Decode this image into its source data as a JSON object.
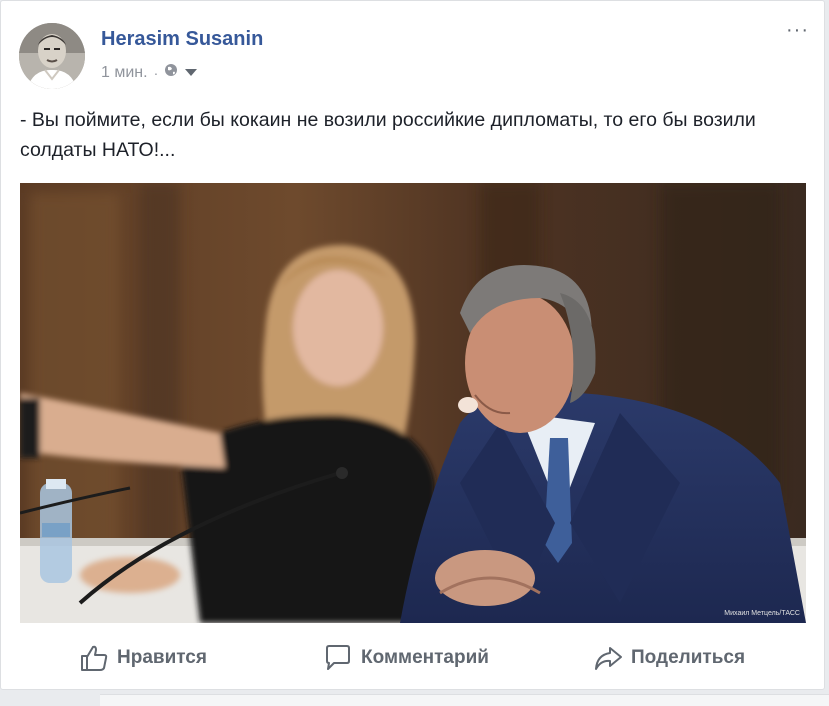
{
  "post": {
    "author": "Herasim Susanin",
    "time": "1 мин.",
    "separator": "·",
    "more": "···",
    "text": "- Вы поймите, если бы кокаин не возили российкие дипломаты, то его бы возили солдаты НАТО!...",
    "photo_caption": "Михаил Метцель/ТАСС"
  },
  "actions": {
    "like": "Нравится",
    "comment": "Комментарий",
    "share": "Поделиться"
  },
  "colors": {
    "author": "#365899",
    "meta": "#90949c",
    "text": "#1d2129",
    "action": "#606770"
  },
  "icons": [
    "globe-icon",
    "chevron-down-icon",
    "more-icon",
    "like-icon",
    "comment-icon",
    "share-icon"
  ]
}
